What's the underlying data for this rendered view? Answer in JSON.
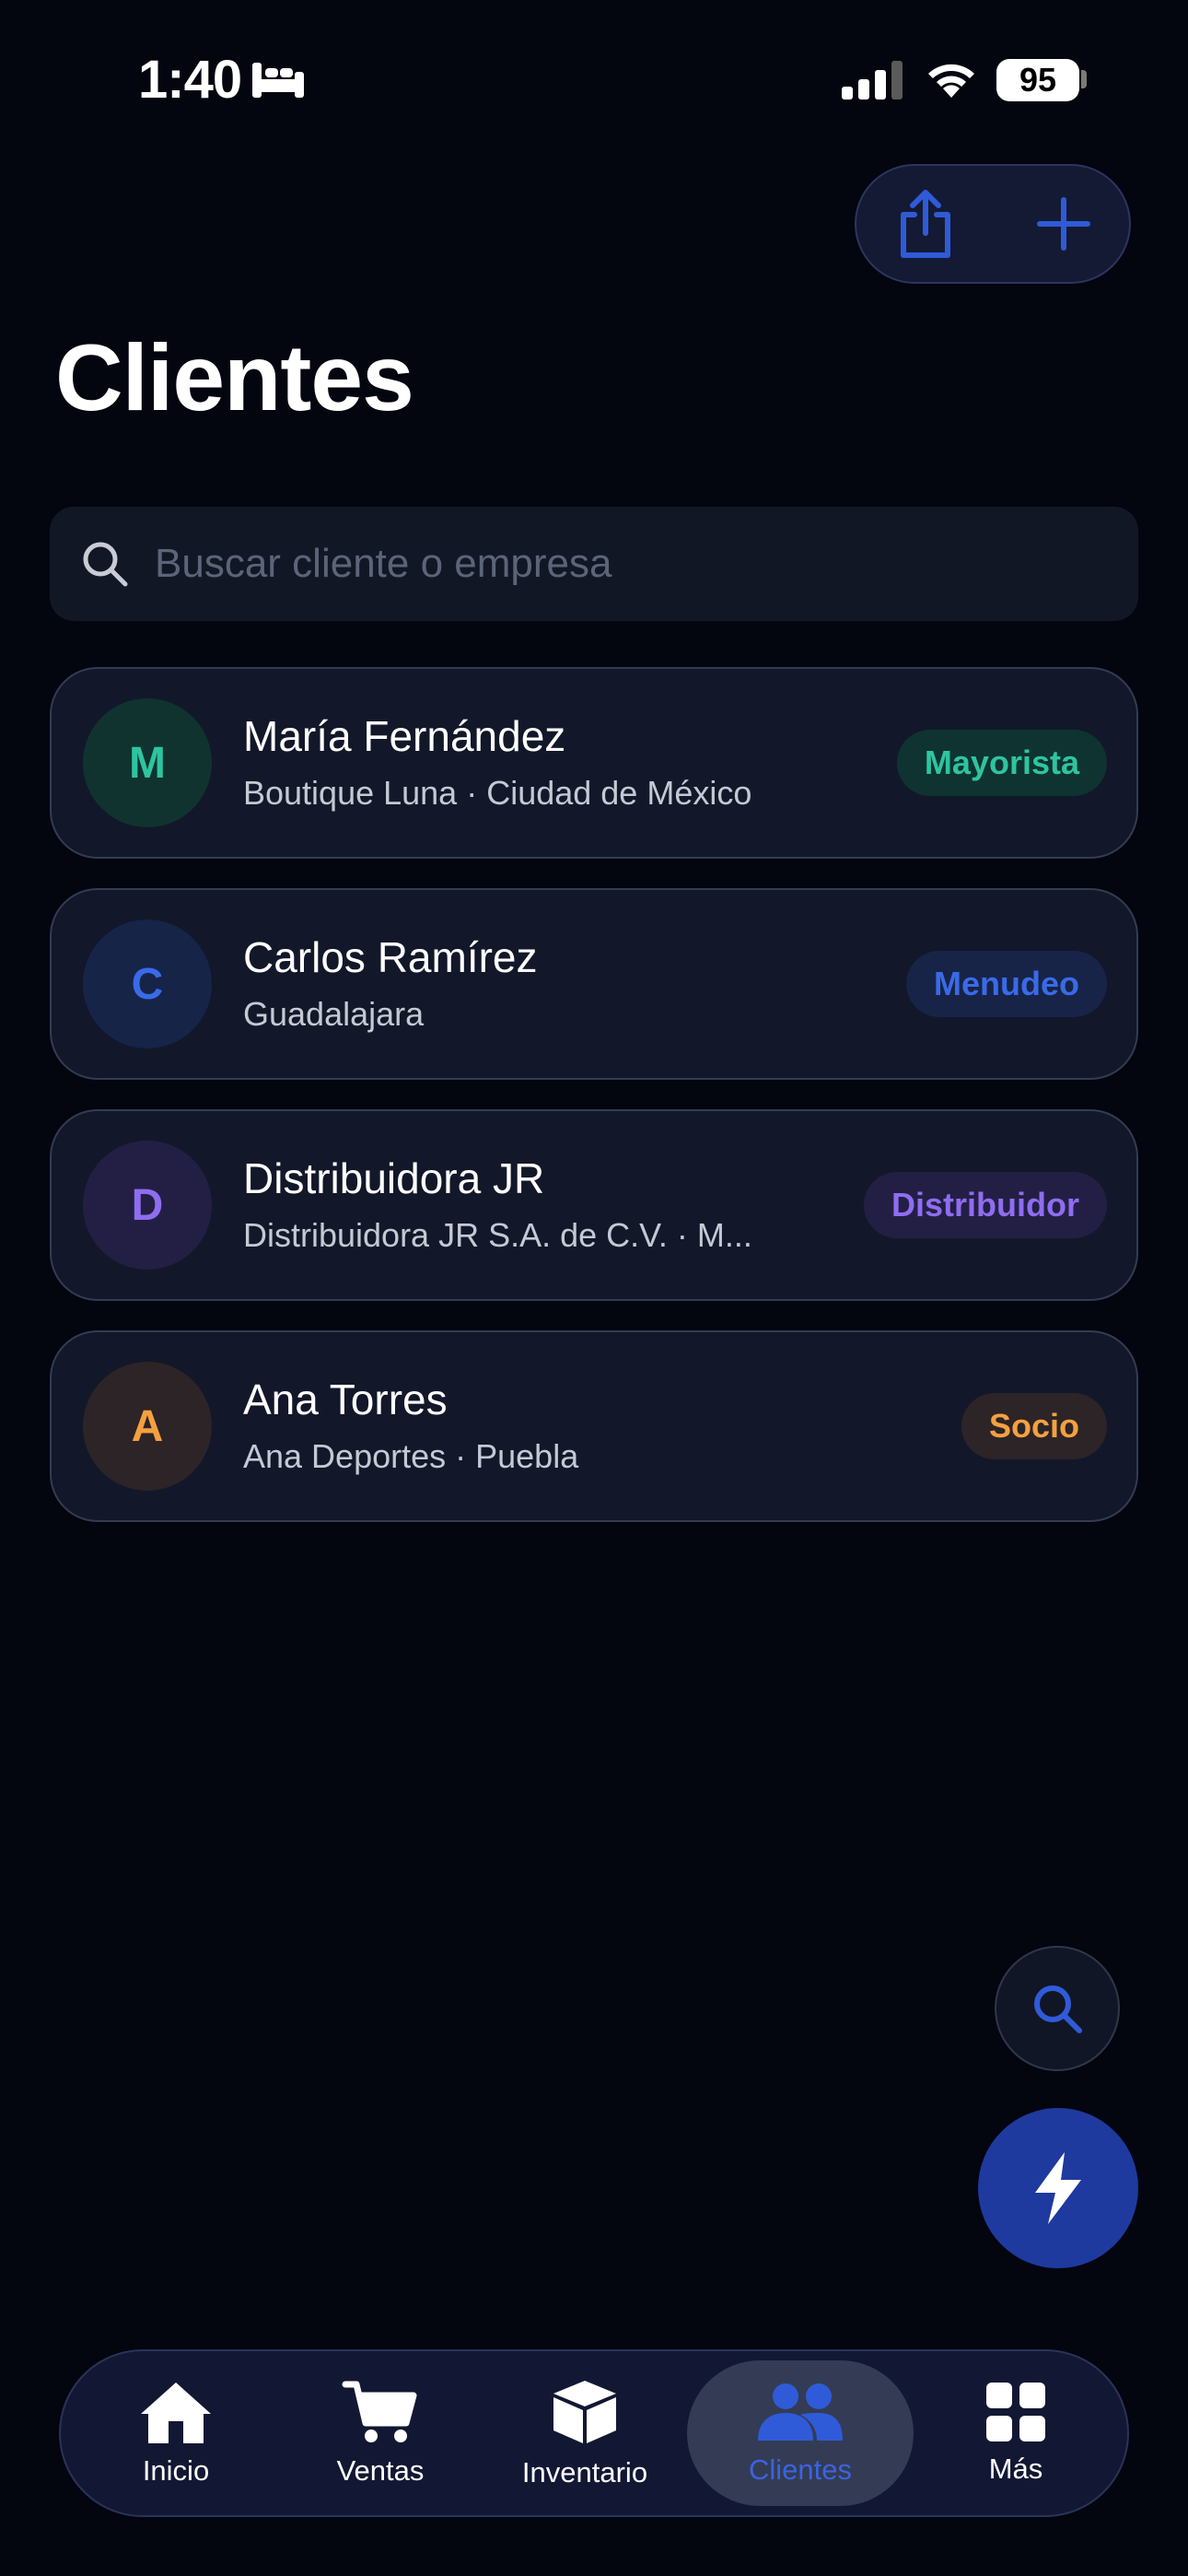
{
  "status_bar": {
    "time": "1:40",
    "battery": "95"
  },
  "page": {
    "title": "Clientes"
  },
  "search": {
    "placeholder": "Buscar cliente o empresa"
  },
  "clients": [
    {
      "initial": "M",
      "name": "María Fernández",
      "subtitle": "Boutique Luna · Ciudad de México",
      "tag": "Mayorista",
      "tag_color": "#2ec4a0"
    },
    {
      "initial": "C",
      "name": "Carlos Ramírez",
      "subtitle": "Guadalajara",
      "tag": "Menudeo",
      "tag_color": "#3a6ae8"
    },
    {
      "initial": "D",
      "name": "Distribuidora JR",
      "subtitle": "Distribuidora JR S.A. de C.V. · M...",
      "tag": "Distribuidor",
      "tag_color": "#8f6df0"
    },
    {
      "initial": "A",
      "name": "Ana Torres",
      "subtitle": "Ana Deportes · Puebla",
      "tag": "Socio",
      "tag_color": "#f5a040"
    }
  ],
  "tabbar": {
    "items": [
      {
        "label": "Inicio",
        "icon": "home-icon"
      },
      {
        "label": "Ventas",
        "icon": "cart-icon"
      },
      {
        "label": "Inventario",
        "icon": "box-icon"
      },
      {
        "label": "Clientes",
        "icon": "users-icon",
        "active": true
      },
      {
        "label": "Más",
        "icon": "grid-icon"
      }
    ]
  },
  "colors": {
    "accent": "#2f5bd8",
    "background": "#03050f",
    "card": "#121829"
  }
}
